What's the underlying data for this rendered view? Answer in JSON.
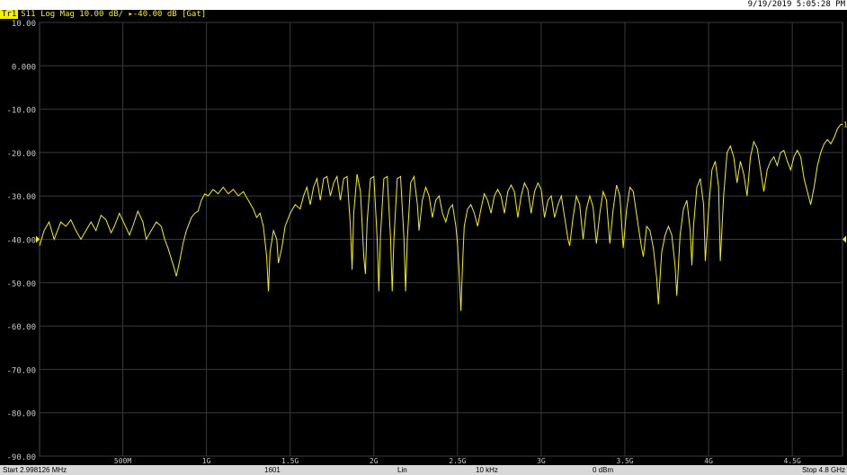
{
  "window": {
    "timestamp": "9/19/2019 5:05:28 PM"
  },
  "trace": {
    "id": "Tr1",
    "label": "S11 Log Mag 10.00 dB/ ▸-40.00 dB [Gat]",
    "color": "#f5f000",
    "reference_marker": "▸"
  },
  "status": {
    "start": "Start 2.998126 MHz",
    "points": "1601",
    "sweep_type": "Lin",
    "ifbw": "10 kHz",
    "power": "0 dBm",
    "stop": "Stop 4.8 GHz"
  },
  "chart_data": {
    "type": "line",
    "title": "",
    "xlabel": "",
    "ylabel": "",
    "xlim": [
      0.002998126,
      4.8
    ],
    "ylim": [
      -90,
      10
    ],
    "grid": true,
    "y_ticks": [
      "10.00",
      "0.000",
      "-10.00",
      "-20.00",
      "-30.00",
      "-40.00",
      "-50.00",
      "-60.00",
      "-70.00",
      "-80.00",
      "-90.00"
    ],
    "y_tick_values": [
      10,
      0,
      -10,
      -20,
      -30,
      -40,
      -50,
      -60,
      -70,
      -80,
      -90
    ],
    "x_ticks": [
      "500M",
      "1G",
      "1.5G",
      "2G",
      "2.5G",
      "3G",
      "3.5G",
      "4G",
      "4.5G"
    ],
    "x_tick_values": [
      0.5,
      1.0,
      1.5,
      2.0,
      2.5,
      3.0,
      3.5,
      4.0,
      4.5
    ],
    "reference_level": -40,
    "series": [
      {
        "values": [
          [
            0.003,
            -41.5
          ],
          [
            0.03,
            -38
          ],
          [
            0.06,
            -36
          ],
          [
            0.09,
            -40
          ],
          [
            0.11,
            -38
          ],
          [
            0.13,
            -36
          ],
          [
            0.16,
            -37
          ],
          [
            0.19,
            -35.5
          ],
          [
            0.22,
            -38
          ],
          [
            0.25,
            -40
          ],
          [
            0.28,
            -38
          ],
          [
            0.31,
            -36
          ],
          [
            0.34,
            -38
          ],
          [
            0.37,
            -34.5
          ],
          [
            0.4,
            -35.5
          ],
          [
            0.43,
            -38.5
          ],
          [
            0.45,
            -37
          ],
          [
            0.48,
            -34
          ],
          [
            0.51,
            -36.5
          ],
          [
            0.54,
            -39
          ],
          [
            0.56,
            -37
          ],
          [
            0.59,
            -33.5
          ],
          [
            0.62,
            -36
          ],
          [
            0.64,
            -40
          ],
          [
            0.67,
            -38
          ],
          [
            0.7,
            -36
          ],
          [
            0.73,
            -37
          ],
          [
            0.75,
            -40
          ],
          [
            0.77,
            -42
          ],
          [
            0.79,
            -44.5
          ],
          [
            0.81,
            -47
          ],
          [
            0.82,
            -48.5
          ],
          [
            0.84,
            -45
          ],
          [
            0.86,
            -41
          ],
          [
            0.88,
            -38
          ],
          [
            0.91,
            -35
          ],
          [
            0.93,
            -34
          ],
          [
            0.95,
            -33.5
          ],
          [
            0.97,
            -31
          ],
          [
            0.99,
            -29.5
          ],
          [
            1.01,
            -30
          ],
          [
            1.04,
            -28.5
          ],
          [
            1.07,
            -29.5
          ],
          [
            1.1,
            -28
          ],
          [
            1.13,
            -29.5
          ],
          [
            1.16,
            -28.5
          ],
          [
            1.19,
            -30
          ],
          [
            1.22,
            -29
          ],
          [
            1.25,
            -31
          ],
          [
            1.28,
            -33
          ],
          [
            1.3,
            -35
          ],
          [
            1.32,
            -34
          ],
          [
            1.34,
            -37
          ],
          [
            1.36,
            -44
          ],
          [
            1.37,
            -52
          ],
          [
            1.38,
            -43
          ],
          [
            1.4,
            -38
          ],
          [
            1.42,
            -40
          ],
          [
            1.43,
            -45.5
          ],
          [
            1.45,
            -42
          ],
          [
            1.47,
            -37
          ],
          [
            1.5,
            -34
          ],
          [
            1.53,
            -32
          ],
          [
            1.56,
            -33
          ],
          [
            1.58,
            -30
          ],
          [
            1.6,
            -28
          ],
          [
            1.62,
            -32
          ],
          [
            1.64,
            -28
          ],
          [
            1.66,
            -26
          ],
          [
            1.68,
            -31
          ],
          [
            1.7,
            -26
          ],
          [
            1.72,
            -25.5
          ],
          [
            1.74,
            -30
          ],
          [
            1.76,
            -27
          ],
          [
            1.78,
            -25.5
          ],
          [
            1.8,
            -31
          ],
          [
            1.82,
            -26
          ],
          [
            1.84,
            -25.5
          ],
          [
            1.86,
            -37
          ],
          [
            1.87,
            -47
          ],
          [
            1.88,
            -34
          ],
          [
            1.9,
            -25
          ],
          [
            1.92,
            -29
          ],
          [
            1.94,
            -44
          ],
          [
            1.95,
            -48
          ],
          [
            1.96,
            -36
          ],
          [
            1.98,
            -26
          ],
          [
            2.0,
            -25.5
          ],
          [
            2.02,
            -40
          ],
          [
            2.03,
            -52
          ],
          [
            2.04,
            -39
          ],
          [
            2.06,
            -26
          ],
          [
            2.08,
            -25.5
          ],
          [
            2.1,
            -40
          ],
          [
            2.11,
            -52
          ],
          [
            2.12,
            -40
          ],
          [
            2.14,
            -26
          ],
          [
            2.16,
            -25.5
          ],
          [
            2.18,
            -40
          ],
          [
            2.19,
            -52
          ],
          [
            2.2,
            -40
          ],
          [
            2.22,
            -27
          ],
          [
            2.24,
            -25.5
          ],
          [
            2.26,
            -32
          ],
          [
            2.27,
            -38
          ],
          [
            2.29,
            -31
          ],
          [
            2.31,
            -28
          ],
          [
            2.33,
            -30
          ],
          [
            2.35,
            -35
          ],
          [
            2.37,
            -31
          ],
          [
            2.39,
            -30
          ],
          [
            2.41,
            -34
          ],
          [
            2.43,
            -36
          ],
          [
            2.45,
            -33
          ],
          [
            2.47,
            -32
          ],
          [
            2.49,
            -37
          ],
          [
            2.5,
            -41
          ],
          [
            2.51,
            -48
          ],
          [
            2.52,
            -56.5
          ],
          [
            2.53,
            -46
          ],
          [
            2.54,
            -37
          ],
          [
            2.56,
            -33
          ],
          [
            2.58,
            -32
          ],
          [
            2.6,
            -34
          ],
          [
            2.62,
            -37
          ],
          [
            2.64,
            -33
          ],
          [
            2.66,
            -29.5
          ],
          [
            2.68,
            -31
          ],
          [
            2.7,
            -34
          ],
          [
            2.72,
            -30
          ],
          [
            2.74,
            -28.5
          ],
          [
            2.76,
            -30
          ],
          [
            2.78,
            -34
          ],
          [
            2.8,
            -29
          ],
          [
            2.82,
            -27.5
          ],
          [
            2.84,
            -29
          ],
          [
            2.86,
            -35
          ],
          [
            2.88,
            -30
          ],
          [
            2.9,
            -27
          ],
          [
            2.92,
            -28.5
          ],
          [
            2.94,
            -34
          ],
          [
            2.96,
            -29
          ],
          [
            2.98,
            -27
          ],
          [
            3.0,
            -28.5
          ],
          [
            3.02,
            -35
          ],
          [
            3.04,
            -31
          ],
          [
            3.06,
            -30
          ],
          [
            3.08,
            -35
          ],
          [
            3.1,
            -32
          ],
          [
            3.12,
            -30
          ],
          [
            3.14,
            -35
          ],
          [
            3.16,
            -40
          ],
          [
            3.17,
            -41.5
          ],
          [
            3.19,
            -35
          ],
          [
            3.21,
            -30
          ],
          [
            3.23,
            -32
          ],
          [
            3.25,
            -40
          ],
          [
            3.27,
            -33
          ],
          [
            3.29,
            -30
          ],
          [
            3.31,
            -32.5
          ],
          [
            3.33,
            -41
          ],
          [
            3.35,
            -34
          ],
          [
            3.37,
            -29
          ],
          [
            3.39,
            -31
          ],
          [
            3.41,
            -41
          ],
          [
            3.43,
            -33
          ],
          [
            3.45,
            -27.5
          ],
          [
            3.47,
            -30
          ],
          [
            3.49,
            -42
          ],
          [
            3.51,
            -33
          ],
          [
            3.53,
            -28
          ],
          [
            3.55,
            -29
          ],
          [
            3.58,
            -37
          ],
          [
            3.6,
            -42
          ],
          [
            3.61,
            -44
          ],
          [
            3.63,
            -37
          ],
          [
            3.65,
            -38
          ],
          [
            3.67,
            -42
          ],
          [
            3.69,
            -49
          ],
          [
            3.7,
            -55
          ],
          [
            3.72,
            -43
          ],
          [
            3.74,
            -39
          ],
          [
            3.76,
            -37
          ],
          [
            3.78,
            -39
          ],
          [
            3.8,
            -46
          ],
          [
            3.81,
            -53
          ],
          [
            3.83,
            -39
          ],
          [
            3.85,
            -33
          ],
          [
            3.87,
            -31
          ],
          [
            3.89,
            -38
          ],
          [
            3.9,
            -46
          ],
          [
            3.91,
            -37
          ],
          [
            3.93,
            -28
          ],
          [
            3.95,
            -26
          ],
          [
            3.97,
            -32
          ],
          [
            3.98,
            -45
          ],
          [
            4.0,
            -33
          ],
          [
            4.02,
            -24
          ],
          [
            4.04,
            -22
          ],
          [
            4.06,
            -28
          ],
          [
            4.07,
            -45
          ],
          [
            4.09,
            -30
          ],
          [
            4.11,
            -20
          ],
          [
            4.13,
            -18.5
          ],
          [
            4.15,
            -21
          ],
          [
            4.17,
            -27
          ],
          [
            4.19,
            -22
          ],
          [
            4.21,
            -25
          ],
          [
            4.23,
            -30
          ],
          [
            4.25,
            -21
          ],
          [
            4.27,
            -17.5
          ],
          [
            4.29,
            -19
          ],
          [
            4.31,
            -24
          ],
          [
            4.33,
            -29
          ],
          [
            4.35,
            -24
          ],
          [
            4.37,
            -22
          ],
          [
            4.39,
            -21
          ],
          [
            4.41,
            -23
          ],
          [
            4.43,
            -20
          ],
          [
            4.45,
            -19.5
          ],
          [
            4.47,
            -22
          ],
          [
            4.49,
            -24
          ],
          [
            4.51,
            -21
          ],
          [
            4.53,
            -19.5
          ],
          [
            4.55,
            -21
          ],
          [
            4.57,
            -26
          ],
          [
            4.59,
            -29
          ],
          [
            4.61,
            -32
          ],
          [
            4.63,
            -28
          ],
          [
            4.65,
            -23
          ],
          [
            4.67,
            -20
          ],
          [
            4.69,
            -18
          ],
          [
            4.71,
            -17
          ],
          [
            4.73,
            -18
          ],
          [
            4.75,
            -16.5
          ],
          [
            4.77,
            -14.5
          ],
          [
            4.79,
            -13.5
          ],
          [
            4.8,
            -13.5
          ]
        ]
      }
    ]
  }
}
